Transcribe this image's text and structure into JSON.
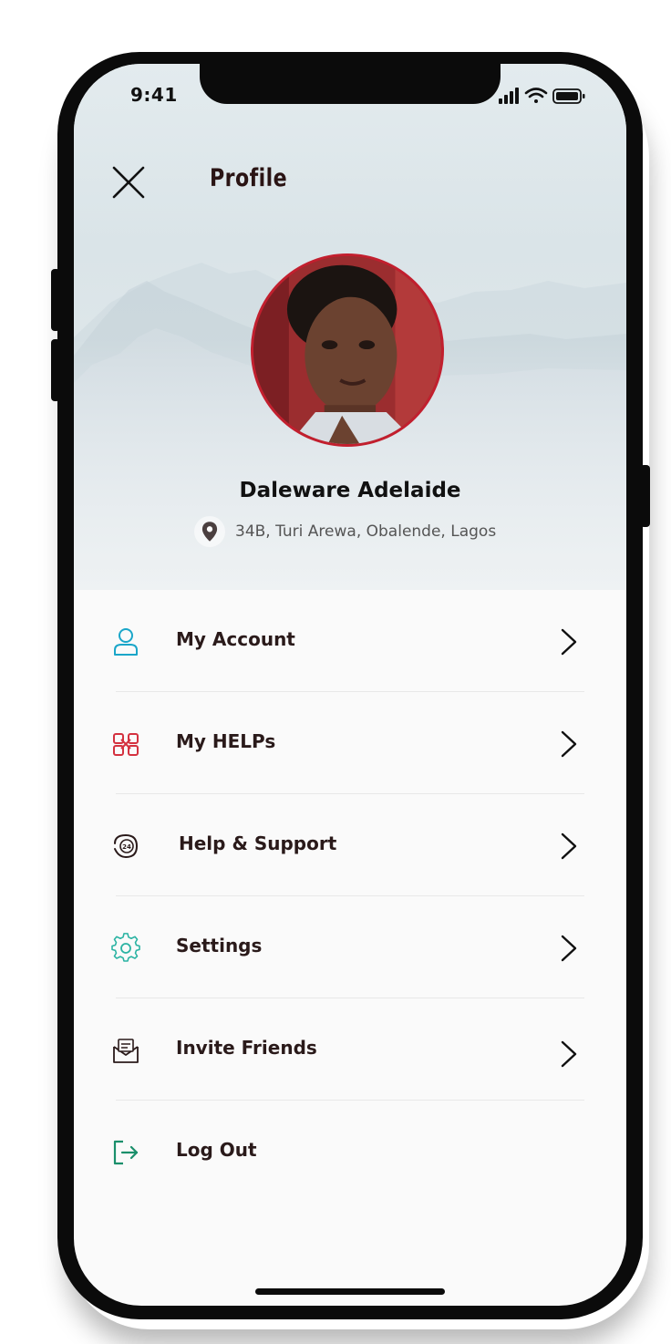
{
  "status_bar": {
    "time": "9:41"
  },
  "header": {
    "close_icon": "close-icon",
    "title": "Profile"
  },
  "profile": {
    "name": "Daleware Adelaide",
    "location_icon": "location-pin-icon",
    "address": "34B, Turi Arewa, Obalende, Lagos",
    "avatar_border_color": "#c21f2e"
  },
  "menu": {
    "items": [
      {
        "label": "My Account",
        "icon": "user-icon",
        "icon_color": "#1aa6c9",
        "has_chevron": true
      },
      {
        "label": "My HELPs",
        "icon": "helping-hands-icon",
        "icon_color": "#d4313f",
        "has_chevron": true
      },
      {
        "label": "Help & Support",
        "icon": "support-24-icon",
        "icon_color": "#2a1a1a",
        "has_chevron": true
      },
      {
        "label": "Settings",
        "icon": "gear-icon",
        "icon_color": "#2bb3a3",
        "has_chevron": true
      },
      {
        "label": "Invite Friends",
        "icon": "envelope-icon",
        "icon_color": "#2a1a1a",
        "has_chevron": true
      },
      {
        "label": "Log Out",
        "icon": "logout-icon",
        "icon_color": "#1a8f6b",
        "has_chevron": false
      }
    ]
  }
}
